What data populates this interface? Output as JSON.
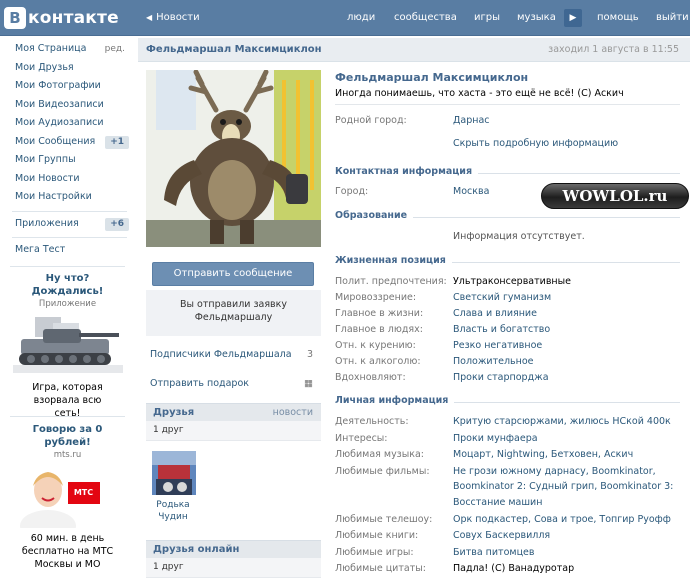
{
  "header": {
    "logo_letter": "B",
    "logo_text": "контакте",
    "back_label": "Новости",
    "nav": [
      "люди",
      "сообщества",
      "игры",
      "музыка",
      "помощь",
      "выйти"
    ]
  },
  "menu": {
    "items": [
      {
        "label": "Моя Страница",
        "extra": "ред."
      },
      {
        "label": "Мои Друзья"
      },
      {
        "label": "Мои Фотографии"
      },
      {
        "label": "Мои Видеозаписи"
      },
      {
        "label": "Мои Аудиозаписи"
      },
      {
        "label": "Мои Сообщения",
        "count": "+1"
      },
      {
        "label": "Мои Группы"
      },
      {
        "label": "Мои Новости"
      },
      {
        "label": "Мои Настройки"
      }
    ],
    "apps": {
      "label": "Приложения",
      "count": "+6"
    },
    "mega_test": "Мега Тест"
  },
  "ads": [
    {
      "title": "Ну что? Дождались!",
      "subtitle": "Приложение",
      "text": "Игра, которая взорвала всю сеть!"
    },
    {
      "title": "Говорю за 0 рублей!",
      "subtitle": "mts.ru",
      "logo": "МТС",
      "text": "60 мин. в день бесплатно на МТС Москвы и МО"
    }
  ],
  "profile": {
    "header_name": "Фельдмаршал Максимциклон",
    "last_seen": "заходил 1 августа в 11:55",
    "full_name": "Фельдмаршал Максимциклон",
    "status": "Иногда понимаешь, что хаста - это ещё не всё! (С) Аскич",
    "send_message": "Отправить сообщение",
    "request_sent": "Вы отправили заявку Фельдмаршалу",
    "subscribers": {
      "label": "Подписчики Фельдмаршала",
      "count": "3"
    },
    "send_gift": "Отправить подарок",
    "friends": {
      "title": "Друзья",
      "link": "новости",
      "count": "1 друг",
      "friend_name": "Родька Чудин"
    },
    "friends_online": {
      "title": "Друзья онлайн",
      "count": "1 друг"
    }
  },
  "info": {
    "hometown": {
      "label": "Родной город:",
      "value": "Дарнас"
    },
    "hide_details": "Скрыть подробную информацию",
    "contacts_title": "Контактная информация",
    "city": {
      "label": "Город:",
      "value": "Москва"
    },
    "education_title": "Образование",
    "education_none": "Информация отсутствует.",
    "position_title": "Жизненная позиция",
    "position": [
      {
        "label": "Полит. предпочтения:",
        "value": "Ультраконсервативные",
        "plain": true
      },
      {
        "label": "Мировоззрение:",
        "value": "Светский гуманизм"
      },
      {
        "label": "Главное в жизни:",
        "value": "Слава и влияние"
      },
      {
        "label": "Главное в людях:",
        "value": "Власть и богатство"
      },
      {
        "label": "Отн. к курению:",
        "value": "Резко негативное"
      },
      {
        "label": "Отн. к алкоголю:",
        "value": "Положительное"
      },
      {
        "label": "Вдохновляют:",
        "value": "Проки старпорджа"
      }
    ],
    "personal_title": "Личная информация",
    "personal": [
      {
        "label": "Деятельность:",
        "value": "Критую старсюржами, жилюсь НСкой 400к"
      },
      {
        "label": "Интересы:",
        "value": "Проки мунфаера"
      },
      {
        "label": "Любимая музыка:",
        "value": "Моцарт, Nightwing, Бетховен, Аскич"
      },
      {
        "label": "Любимые фильмы:",
        "value": "Не грози южному дарнасу, Boomkinator, Boomkinator 2: Судный грип, Boomkinator 3: Восстание машин"
      },
      {
        "label": "Любимые телешоу:",
        "value": "Орк подкастер, Сова и трое, Топгир Руофф"
      },
      {
        "label": "Любимые книги:",
        "value": "Совух Баскервилля"
      },
      {
        "label": "Любимые игры:",
        "value": "Битва питомцев"
      },
      {
        "label": "Любимые цитаты:",
        "value": "Падла! (С) Ванадуротар",
        "plain": true
      }
    ]
  },
  "watermark": "WOWLOL.ru",
  "colors": {
    "topbar": "#597da3",
    "link": "#2b587a",
    "section": "#45688e"
  }
}
